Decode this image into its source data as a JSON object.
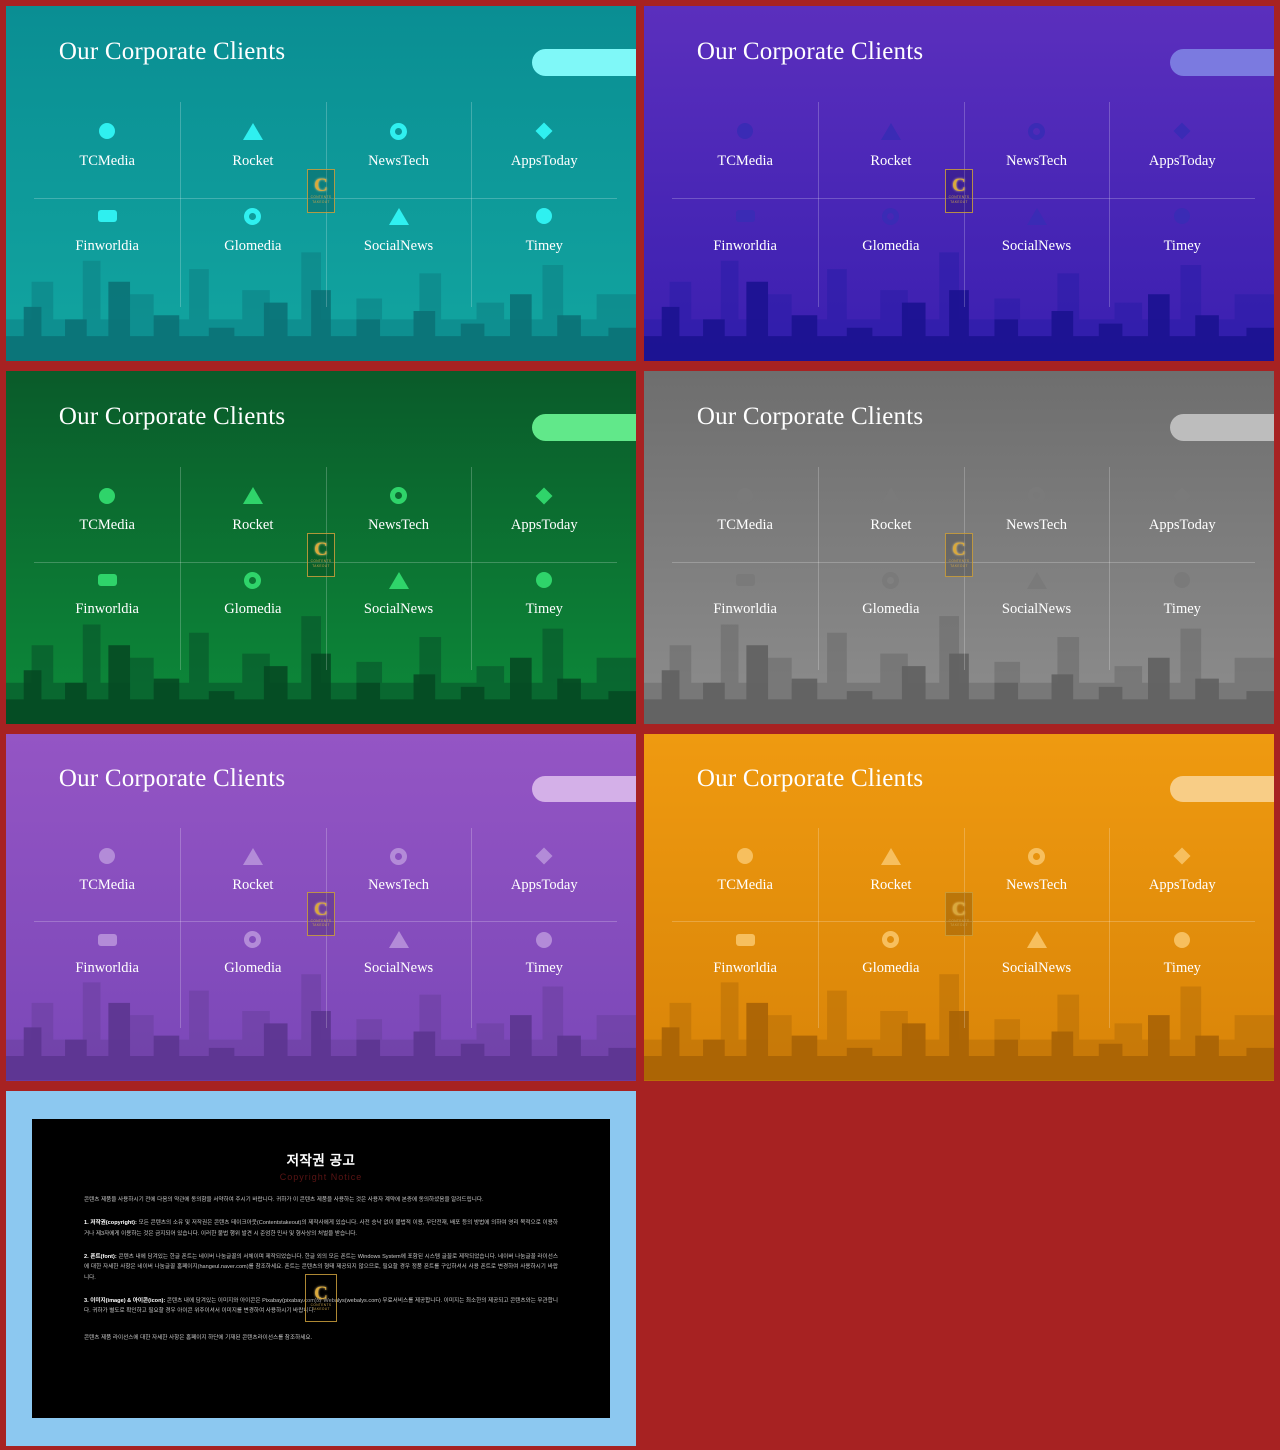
{
  "page": {
    "background_color": "#a72222",
    "watermark": {
      "letter": "C",
      "line1": "CONTENTS",
      "line2": "TAKEOUT",
      "color": "#d9a93c"
    }
  },
  "slide_common": {
    "title": "Our Corporate Clients",
    "clients_row1": [
      {
        "label": "TCMedia",
        "icon": "filled-circle-icon"
      },
      {
        "label": "Rocket",
        "icon": "triangle-icon"
      },
      {
        "label": "NewsTech",
        "icon": "ring-icon"
      },
      {
        "label": "AppsToday",
        "icon": "diamond-icon"
      }
    ],
    "clients_row2": [
      {
        "label": "Finworldia",
        "icon": "rounded-rect-icon"
      },
      {
        "label": "Glomedia",
        "icon": "ring-icon"
      },
      {
        "label": "SocialNews",
        "icon": "triangle-icon"
      },
      {
        "label": "Timey",
        "icon": "filled-circle-icon"
      }
    ]
  },
  "slides": [
    {
      "name": "teal",
      "bg_top": "#0a8e93",
      "bg_bottom": "#12a5a0",
      "accent": "#2ff0f0",
      "pill": "#7ff8f8",
      "sky": "#0d7f83",
      "sky2": "#0b7277",
      "title_color": "#ffffff"
    },
    {
      "name": "indigo",
      "bg_top": "#5b2fbd",
      "bg_bottom": "#3a1fb0",
      "accent": "#3a2bb5",
      "pill": "#7b7ae0",
      "sky": "#2a1da8",
      "sky2": "#1b1290",
      "title_color": "#ffffff"
    },
    {
      "name": "green",
      "bg_top": "#0a5b2a",
      "bg_bottom": "#0d8a3a",
      "accent": "#2fd46a",
      "pill": "#61e88a",
      "sky": "#07512a",
      "sky2": "#064a24",
      "title_color": "#ffffff"
    },
    {
      "name": "gray",
      "bg_top": "#6e6e6e",
      "bg_bottom": "#8d8d8d",
      "accent": "#7a7a7a",
      "pill": "#bdbdbd",
      "sky": "#6a6a6a",
      "sky2": "#606060",
      "title_color": "#ffffff"
    },
    {
      "name": "purple",
      "bg_top": "#9455c4",
      "bg_bottom": "#7a47b8",
      "accent": "#b38bd8",
      "pill": "#d4b0e8",
      "sky": "#6a3f9f",
      "sky2": "#5c3590",
      "title_color": "#ffffff"
    },
    {
      "name": "orange",
      "bg_top": "#ef9a10",
      "bg_bottom": "#d98408",
      "accent": "#f7bf5e",
      "pill": "#f8cd86",
      "sky": "#b86f08",
      "sky2": "#a86306",
      "title_color": "#ffffff"
    }
  ],
  "notice": {
    "frame_color": "#8cc8f0",
    "title": "저작권 공고",
    "subtitle": "Copyright Notice",
    "intro": "콘텐츠 제품을 사용하시기 전에 다음의 약관에 동의함을 서약하여 주시기 바랍니다. 귀하가 이 콘텐츠 제품을 사용하는 것은 사용자 계약에 본증에 동의하셨음을 알려드립니다.",
    "sections": [
      {
        "heading": "1. 저작권(copyright):",
        "body": "모든 콘텐츠의 소유 및 저작권은 콘텐츠 테이크아웃(Contentstakeout)의 제작사에게 있습니다. 사전 승낙 없이 불법적 이용, 무단전재, 배포 등의 방법에 의하여 영리 목적으로 이용하거나 제3자에게 이용하는 것은 금지되어 있습니다. 이러한 불법 행위 발견 시 준엄한 민사 및 형사상의 처벌을 받습니다."
      },
      {
        "heading": "2. 폰트(font):",
        "body": "콘텐츠 내에 담겨있는 한글 폰트는 네이버 나눔글꼴의 서체이며 제작되었습니다. 한글 외의 모든 폰트는 Windows System에 포함된 시스템 글꼴로 제작되었습니다. 네이버 나눔글꼴 라이선스에 대한 자세한 사항은 네이버 나눔글꼴 홈페이지(hangeul.naver.com)를 참조하세요. 폰트는 콘텐츠의 형태 제공되지 않으므로, 필요할 경우 정품 폰트를 구입하셔서 사용 폰트로 변경하여 사용하시기 바랍니다."
      },
      {
        "heading": "3. 이미지(image) & 아이콘(icon):",
        "body": "콘텐츠 내에 담겨있는 이미지와 아이콘은 Pixabay(pixabay.com)와 Webalys(webalys.com) 무료서비스를 제공합니다. 이미지는 최소한의 제공되고 콘텐츠와는 무관합니다. 귀하가 별도로 확인하고 필요할 경우 아이콘 위주이셔서 이미지를 변경하여 사용하시기 바랍니다."
      }
    ],
    "footer": "콘텐츠 제품 라이선스에 대한 자세한 사항은 홈페이지 하단에 기재된 콘텐츠라이선스를 참조하세요."
  }
}
